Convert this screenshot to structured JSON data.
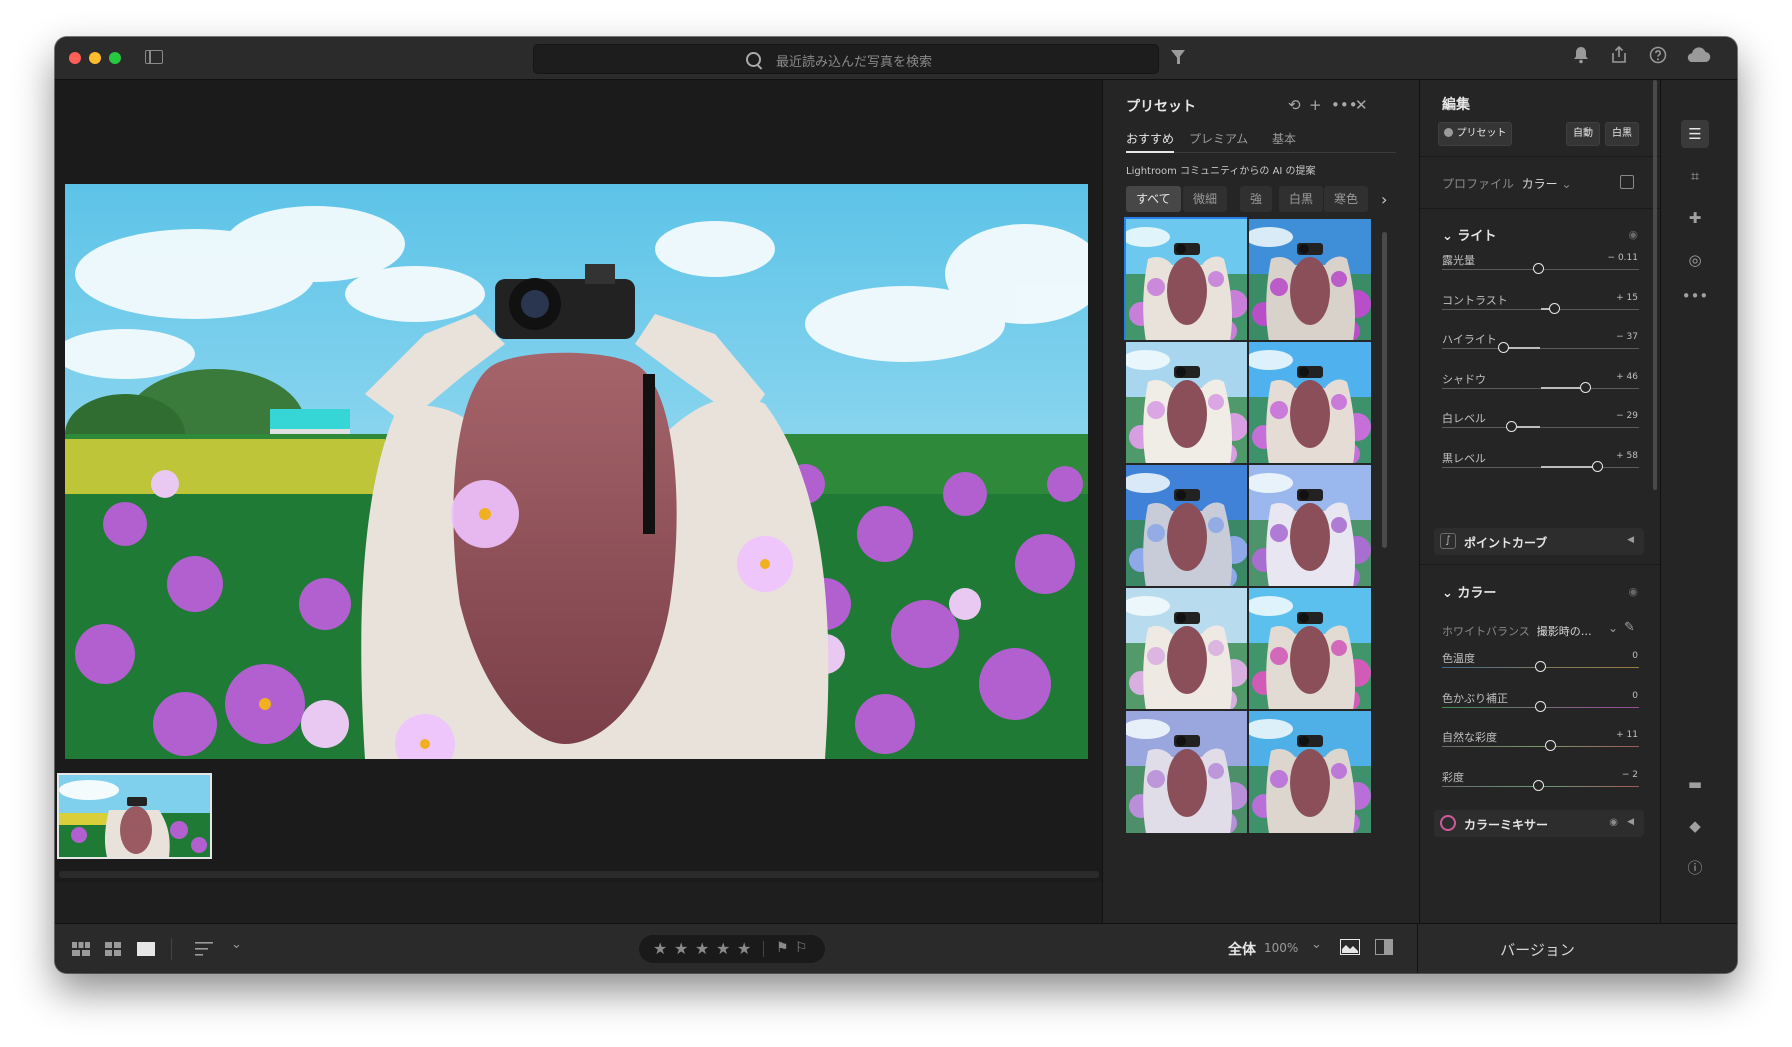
{
  "window": {
    "search_placeholder": "最近読み込んだ写真を検索"
  },
  "toolbar_icons": [
    "bell-icon",
    "share-icon",
    "help-icon",
    "cloud-icon"
  ],
  "presets": {
    "title": "プリセット",
    "tabs": [
      "おすすめ",
      "プレミアム",
      "基本"
    ],
    "active_tab": "おすすめ",
    "ai_label": "Lightroom コミュニティからの AI の提案",
    "chips": [
      "すべて",
      "微細",
      "強",
      "白黒",
      "寒色"
    ],
    "active_chip": "すべて",
    "selected_index": 0
  },
  "edit": {
    "title": "編集",
    "preset_button": "プリセット",
    "auto_button": "自動",
    "bw_button": "白黒",
    "profile_label": "プロファイル",
    "profile_value": "カラー",
    "light": {
      "title": "ライト",
      "sliders": [
        {
          "label": "露光量",
          "value": "− 0.11",
          "pos": 0.49
        },
        {
          "label": "コントラスト",
          "value": "+ 15",
          "pos": 0.575
        },
        {
          "label": "ハイライト",
          "value": "− 37",
          "pos": 0.315
        },
        {
          "label": "シャドウ",
          "value": "+ 46",
          "pos": 0.73
        },
        {
          "label": "白レベル",
          "value": "− 29",
          "pos": 0.355
        },
        {
          "label": "黒レベル",
          "value": "+ 58",
          "pos": 0.79
        }
      ]
    },
    "point_curve": "ポイントカーブ",
    "color": {
      "title": "カラー",
      "wb_label": "ホワイトバランス",
      "wb_value": "撮影時の…",
      "sliders": [
        {
          "label": "色温度",
          "value": "0",
          "pos": 0.5,
          "kind": "temp"
        },
        {
          "label": "色かぶり補正",
          "value": "0",
          "pos": 0.5,
          "kind": "tint"
        },
        {
          "label": "自然な彩度",
          "value": "+ 11",
          "pos": 0.555,
          "kind": "vib"
        },
        {
          "label": "彩度",
          "value": "− 2",
          "pos": 0.49,
          "kind": "sat"
        }
      ]
    },
    "color_mixer": "カラーミキサー"
  },
  "bottom": {
    "zoom_label": "全体",
    "zoom_value": "100%",
    "version_button": "バージョン",
    "rating_stars": 5
  },
  "colors": {
    "accent": "#2680eb",
    "panel": "#252525",
    "stage": "#1b1b1b"
  }
}
